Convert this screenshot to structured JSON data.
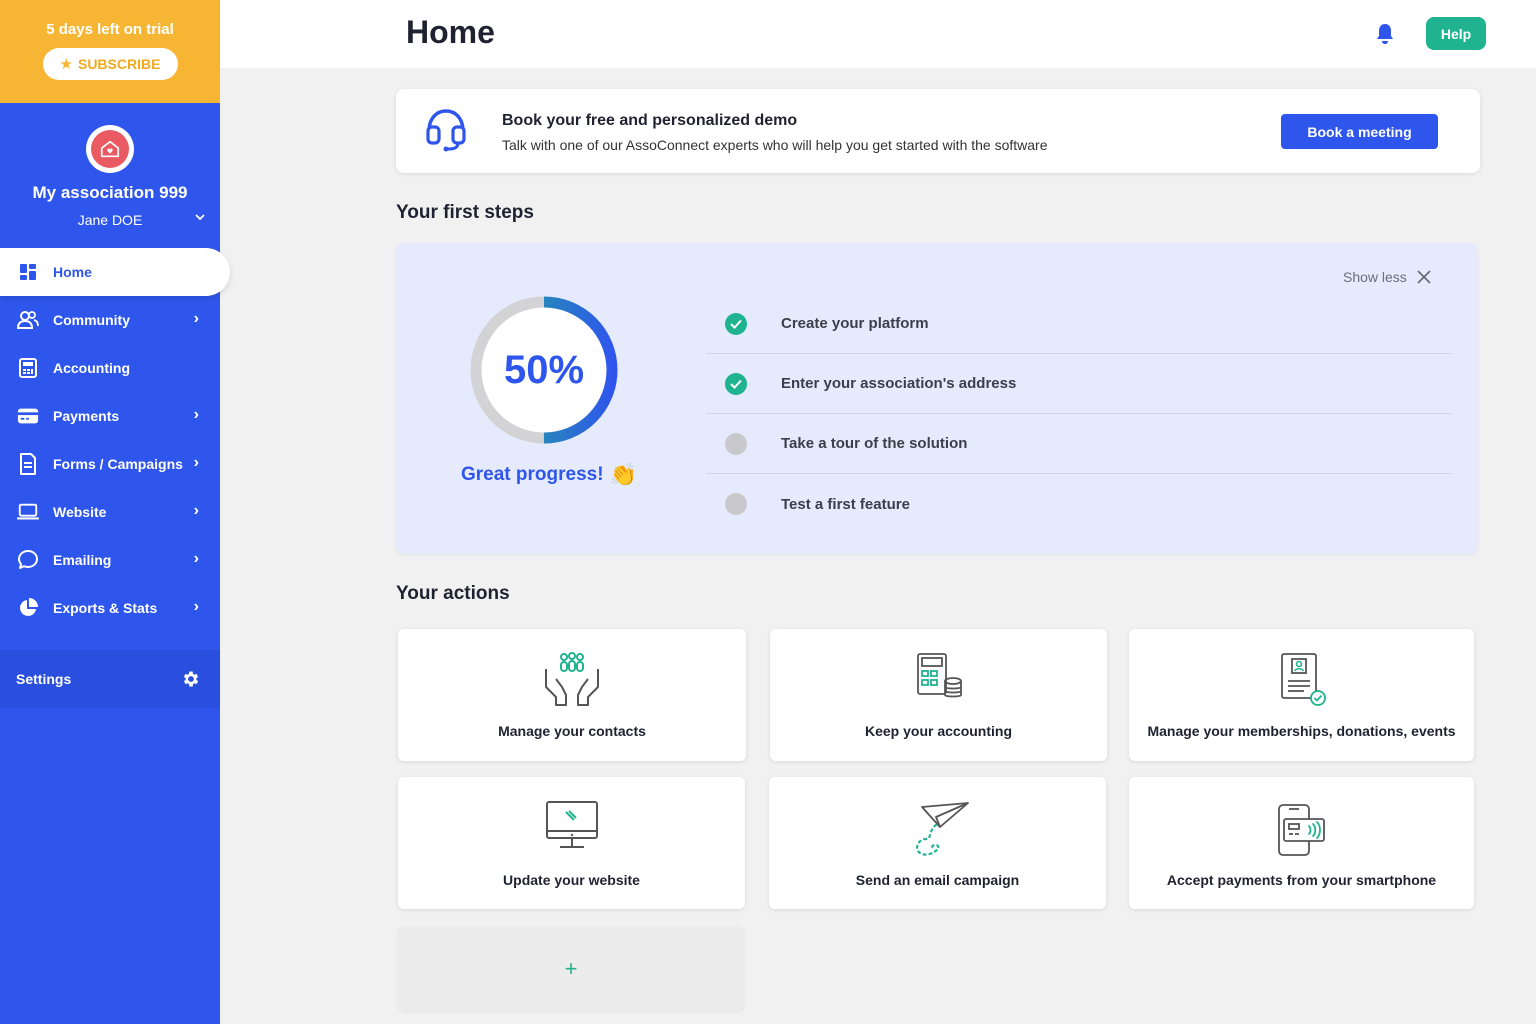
{
  "sidebar": {
    "trial_text": "5 days left on trial",
    "subscribe_label": "SUBSCRIBE",
    "association_name": "My association 999",
    "user_name": "Jane DOE",
    "items": [
      {
        "label": "Home",
        "icon": "dashboard-icon",
        "active": true
      },
      {
        "label": "Community",
        "icon": "users-icon"
      },
      {
        "label": "Accounting",
        "icon": "calculator-icon"
      },
      {
        "label": "Payments",
        "icon": "credit-card-icon"
      },
      {
        "label": "Forms / Campaigns",
        "icon": "document-icon"
      },
      {
        "label": "Website",
        "icon": "laptop-icon"
      },
      {
        "label": "Emailing",
        "icon": "chat-bubble-icon"
      },
      {
        "label": "Exports & Stats",
        "icon": "pie-chart-icon"
      }
    ],
    "settings_label": "Settings"
  },
  "header": {
    "title": "Home",
    "help_label": "Help"
  },
  "demo": {
    "title": "Book your free and personalized demo",
    "subtitle": "Talk with one of our AssoConnect experts who will help you get started with the software",
    "button_label": "Book a meeting"
  },
  "first_steps": {
    "heading": "Your first steps",
    "progress_value": 0.5,
    "progress_text": "50%",
    "progress_message": "Great progress!",
    "show_less_label": "Show less",
    "steps": [
      {
        "label": "Create your platform",
        "done": true
      },
      {
        "label": "Enter your association's address",
        "done": true
      },
      {
        "label": "Take a tour of the solution",
        "done": false
      },
      {
        "label": "Test a first feature",
        "done": false
      }
    ]
  },
  "actions": {
    "heading": "Your actions",
    "cards": [
      {
        "label": "Manage your contacts",
        "icon": "hands-people-icon"
      },
      {
        "label": "Keep your accounting",
        "icon": "calculator-coins-icon"
      },
      {
        "label": "Manage your memberships, donations, events",
        "icon": "membership-document-icon"
      },
      {
        "label": "Update your website",
        "icon": "monitor-icon"
      },
      {
        "label": "Send an email campaign",
        "icon": "paper-plane-icon"
      },
      {
        "label": "Accept payments from your smartphone",
        "icon": "smartphone-payment-icon"
      }
    ],
    "add_label": "+"
  },
  "colors": {
    "brand_blue": "#2f56ec",
    "trial_orange": "#f6b634",
    "accent_green": "#1fb38f",
    "logo_red": "#ea5a62"
  }
}
